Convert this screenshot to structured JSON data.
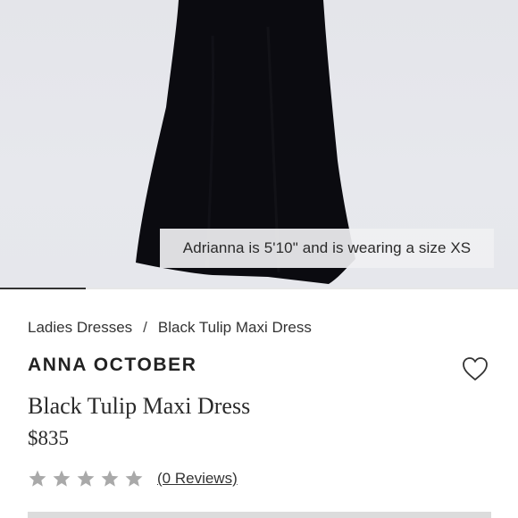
{
  "gallery": {
    "caption": "Adrianna is 5'10\" and is wearing a size XS",
    "progress_fraction": 0.166
  },
  "breadcrumb": {
    "items": [
      "Ladies Dresses",
      "Black Tulip Maxi Dress"
    ],
    "separator": "/"
  },
  "product": {
    "brand": "ANNA OCTOBER",
    "title": "Black Tulip Maxi Dress",
    "price": "$835",
    "rating_value": 0,
    "rating_max": 5,
    "reviews_link": "(0 Reviews)"
  },
  "icons": {
    "favorite": "heart-outline-icon",
    "rating": "star-icon"
  },
  "colors": {
    "star_empty": "#a9a9a9",
    "dress": "#0b0b10",
    "hero_background": "#e5e6eb"
  }
}
